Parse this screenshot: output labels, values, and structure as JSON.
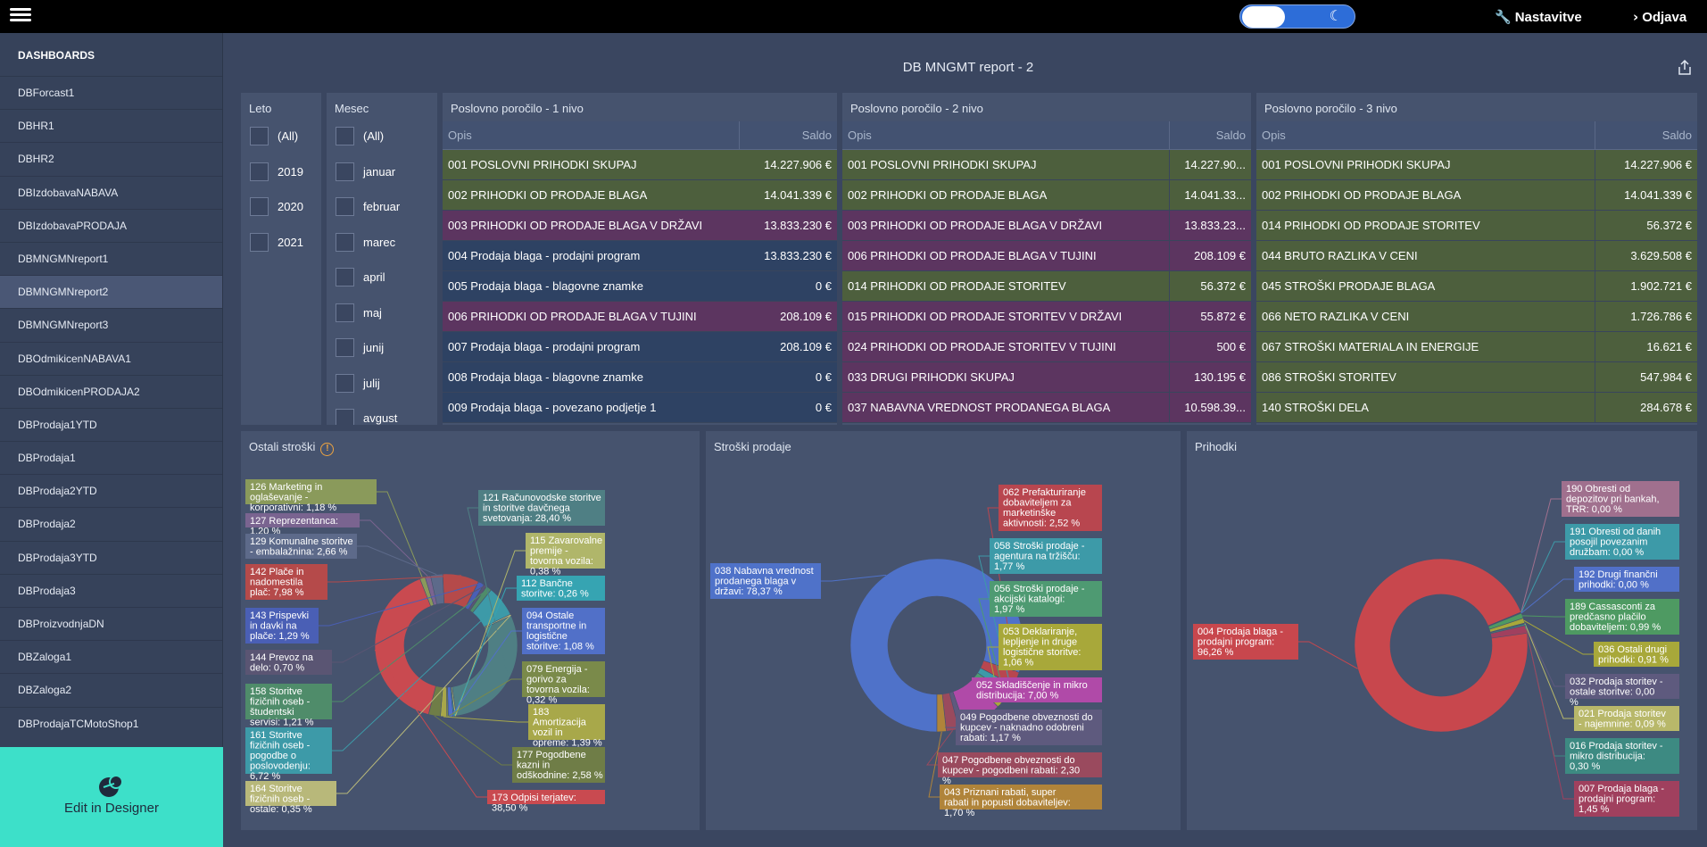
{
  "topbar": {
    "settings_label": "Nastavitve",
    "logout_label": "Odjava",
    "moon_glyph": "☾"
  },
  "sidebar": {
    "title": "DASHBOARDS",
    "items": [
      {
        "label": "DBForcast1"
      },
      {
        "label": "DBHR1"
      },
      {
        "label": "DBHR2"
      },
      {
        "label": "DBIzdobavaNABAVA"
      },
      {
        "label": "DBIzdobavaPRODAJA"
      },
      {
        "label": "DBMNGMNreport1"
      },
      {
        "label": "DBMNGMNreport2",
        "active": true
      },
      {
        "label": "DBMNGMNreport3"
      },
      {
        "label": "DBOdmikicenNABAVA1"
      },
      {
        "label": "DBOdmikicenPRODAJA2"
      },
      {
        "label": "DBProdaja1YTD"
      },
      {
        "label": "DBProdaja1"
      },
      {
        "label": "DBProdaja2YTD"
      },
      {
        "label": "DBProdaja2"
      },
      {
        "label": "DBProdaja3YTD"
      },
      {
        "label": "DBProdaja3"
      },
      {
        "label": "DBProizvodnjaDN"
      },
      {
        "label": "DBZaloga1"
      },
      {
        "label": "DBZaloga2"
      },
      {
        "label": "DBProdajaTCMotoShop1"
      }
    ],
    "designer_label": "Edit in Designer"
  },
  "main": {
    "title": "DB MNGMT report - 2"
  },
  "filters": {
    "leto": {
      "title": "Leto",
      "options": [
        "(All)",
        "2019",
        "2020",
        "2021"
      ]
    },
    "mesec": {
      "title": "Mesec",
      "options": [
        "(All)",
        "januar",
        "februar",
        "marec",
        "april",
        "maj",
        "junij",
        "julij",
        "avgust"
      ]
    }
  },
  "grids": [
    {
      "title": "Poslovno poročilo - 1 nivo",
      "col_opis": "Opis",
      "col_saldo": "Saldo",
      "rows": [
        {
          "opis": "001 POSLOVNI PRIHODKI SKUPAJ",
          "saldo": "14.227.906 €",
          "color": "#4d5f3d"
        },
        {
          "opis": "002 PRIHODKI OD PRODAJE BLAGA",
          "saldo": "14.041.339 €",
          "color": "#4d5f3d"
        },
        {
          "opis": "003 PRIHODKI OD PRODAJE BLAGA V DRŽAVI",
          "saldo": "13.833.230 €",
          "color": "#5c3560"
        },
        {
          "opis": "004 Prodaja blaga - prodajni program",
          "saldo": "13.833.230 €",
          "color": "#2e4263"
        },
        {
          "opis": "005 Prodaja blaga - blagovne znamke",
          "saldo": "0 €",
          "color": "#2e4263"
        },
        {
          "opis": "006 PRIHODKI OD PRODAJE BLAGA V TUJINI",
          "saldo": "208.109 €",
          "color": "#5c3560"
        },
        {
          "opis": "007 Prodaja blaga - prodajni program",
          "saldo": "208.109 €",
          "color": "#2e4263"
        },
        {
          "opis": "008 Prodaja blaga - blagovne znamke",
          "saldo": "0 €",
          "color": "#2e4263"
        },
        {
          "opis": "009 Prodaja blaga - povezano podjetje 1",
          "saldo": "0 €",
          "color": "#2e4263"
        }
      ]
    },
    {
      "title": "Poslovno poročilo - 2 nivo",
      "col_opis": "Opis",
      "col_saldo": "Saldo",
      "rows": [
        {
          "opis": "001 POSLOVNI PRIHODKI SKUPAJ",
          "saldo": "14.227.90...",
          "color": "#4d5f3d"
        },
        {
          "opis": "002 PRIHODKI OD PRODAJE BLAGA",
          "saldo": "14.041.33...",
          "color": "#4d5f3d"
        },
        {
          "opis": "003 PRIHODKI OD PRODAJE BLAGA V DRŽAVI",
          "saldo": "13.833.23...",
          "color": "#5c3560"
        },
        {
          "opis": "006 PRIHODKI OD PRODAJE BLAGA V TUJINI",
          "saldo": "208.109 €",
          "color": "#5c3560"
        },
        {
          "opis": "014 PRIHODKI OD PRODAJE STORITEV",
          "saldo": "56.372 €",
          "color": "#4d5f3d"
        },
        {
          "opis": "015 PRIHODKI OD PRODAJE STORITEV V DRŽAVI",
          "saldo": "55.872 €",
          "color": "#5c3560"
        },
        {
          "opis": "024 PRIHODKI OD PRODAJE STORITEV V TUJINI",
          "saldo": "500 €",
          "color": "#5c3560"
        },
        {
          "opis": "033 DRUGI PRIHODKI SKUPAJ",
          "saldo": "130.195 €",
          "color": "#5c3560"
        },
        {
          "opis": "037 NABAVNA VREDNOST PRODANEGA BLAGA",
          "saldo": "10.598.39...",
          "color": "#5c3560"
        }
      ]
    },
    {
      "title": "Poslovno poročilo - 3 nivo",
      "col_opis": "Opis",
      "col_saldo": "Saldo",
      "rows": [
        {
          "opis": "001 POSLOVNI PRIHODKI SKUPAJ",
          "saldo": "14.227.906 €",
          "color": "#4d5f3d"
        },
        {
          "opis": "002 PRIHODKI OD PRODAJE BLAGA",
          "saldo": "14.041.339 €",
          "color": "#4d5f3d"
        },
        {
          "opis": "014 PRIHODKI OD PRODAJE STORITEV",
          "saldo": "56.372 €",
          "color": "#4d5f3d"
        },
        {
          "opis": "044 BRUTO RAZLIKA V CENI",
          "saldo": "3.629.508 €",
          "color": "#4d5f3d"
        },
        {
          "opis": "045 STROŠKI PRODAJE BLAGA",
          "saldo": "1.902.721 €",
          "color": "#4d5f3d"
        },
        {
          "opis": "066 NETO RAZLIKA V CENI",
          "saldo": "1.726.786 €",
          "color": "#4d5f3d"
        },
        {
          "opis": "067 STROŠKI MATERIALA IN ENERGIJE",
          "saldo": "16.621 €",
          "color": "#4d5f3d"
        },
        {
          "opis": "086 STROŠKI STORITEV",
          "saldo": "547.984 €",
          "color": "#4d5f3d"
        },
        {
          "opis": "140 STROŠKI DELA",
          "saldo": "284.678 €",
          "color": "#4d5f3d"
        }
      ]
    }
  ],
  "chart_data": [
    {
      "type": "pie",
      "title": "Ostali stroški",
      "series": [
        {
          "label": "126 Marketing in oglaševanje - korporativni: 1,18 %",
          "value": 1.18,
          "color": "#8a9a5b",
          "side": "left"
        },
        {
          "label": "127 Reprezentanca: 1,20 %",
          "value": 1.2,
          "color": "#7a6490",
          "side": "left"
        },
        {
          "label": "129 Komunalne storitve - embalažnina: 2,66 %",
          "value": 2.66,
          "color": "#5d6a8a",
          "side": "left"
        },
        {
          "label": "142 Plače in nadomestila plač: 7,98 %",
          "value": 7.98,
          "color": "#b54a4a",
          "side": "left"
        },
        {
          "label": "143 Prispevki in davki na plače: 1,29 %",
          "value": 1.29,
          "color": "#4a5fb5",
          "side": "left"
        },
        {
          "label": "144 Prevoz na delo: 0,70 %",
          "value": 0.7,
          "color": "#5a5573",
          "side": "left"
        },
        {
          "label": "158 Storitve fizičnih oseb - študentski servisi: 1,21 %",
          "value": 1.21,
          "color": "#4f8c6a",
          "side": "left"
        },
        {
          "label": "161 Storitve fizičnih oseb - pogodbe o poslovodenju: 6,72 %",
          "value": 6.72,
          "color": "#3d9aa8",
          "side": "left"
        },
        {
          "label": "164 Storitve fizičnih oseb - ostale: 0,35 %",
          "value": 0.35,
          "color": "#b8b87a",
          "side": "left"
        },
        {
          "label": "121 Računovodske storitve in storitve davčnega svetovanja: 28,40 %",
          "value": 28.4,
          "color": "#4f7f84",
          "side": "right"
        },
        {
          "label": "115 Zavarovalne premije - tovorna vozila: 0,38 %",
          "value": 0.38,
          "color": "#b0b66a",
          "side": "right"
        },
        {
          "label": "112 Bančne storitve: 0,26 %",
          "value": 0.26,
          "color": "#36a4b2",
          "side": "right"
        },
        {
          "label": "094 Ostale transportne in logistične storitve: 1,08 %",
          "value": 1.08,
          "color": "#5170c8",
          "side": "right"
        },
        {
          "label": "079 Energija - gorivo za tovorna vozila: 0,32 %",
          "value": 0.32,
          "color": "#7a8a4a",
          "side": "right"
        },
        {
          "label": "183 Amortizacija vozil in opreme: 1,39 %",
          "value": 1.39,
          "color": "#a8a84a",
          "side": "right"
        },
        {
          "label": "177 Pogodbene kazni in odškodnine: 2,58 %",
          "value": 2.58,
          "color": "#6f7d47",
          "side": "right"
        },
        {
          "label": "173 Odpisi terjatev: 38,50 %",
          "value": 38.5,
          "color": "#c94a50",
          "side": "right"
        }
      ]
    },
    {
      "type": "pie",
      "title": "Stroški prodaje",
      "series": [
        {
          "label": "038 Nabavna vrednost prodanega blaga v državi: 78,37 %",
          "value": 78.37,
          "color": "#4f72c9",
          "side": "left"
        },
        {
          "label": "062 Prefakturiranje dobaviteljem za marketinške aktivnosti: 2,52 %",
          "value": 2.52,
          "color": "#b8464f",
          "side": "right"
        },
        {
          "label": "058 Stroški prodaje - agentura na tržišču: 1,77 %",
          "value": 1.77,
          "color": "#3d9aa8",
          "side": "right"
        },
        {
          "label": "056 Stroški prodaje - akcijski katalogi: 1,97 %",
          "value": 1.97,
          "color": "#4e9a72",
          "side": "right"
        },
        {
          "label": "053 Deklariranje, lepljenje in druge logistične storitve: 1,06 %",
          "value": 1.06,
          "color": "#a8a83a",
          "side": "right"
        },
        {
          "label": "052 Skladiščenje in mikro distribucija: 7,00 %",
          "value": 7.0,
          "color": "#b04aa8",
          "side": "right"
        },
        {
          "label": "049 Pogodbene obveznosti do kupcev - naknadno odobreni rabati: 1,17 %",
          "value": 1.17,
          "color": "#5e5a7e",
          "side": "right"
        },
        {
          "label": "047 Pogodbene obveznosti do kupcev - pogodbeni rabati: 2,30 %",
          "value": 2.3,
          "color": "#9a4a5e",
          "side": "right"
        },
        {
          "label": "043 Priznani rabati, super rabati in popusti dobaviteljev: 1,70 %",
          "value": 1.7,
          "color": "#b0843a",
          "side": "right"
        }
      ]
    },
    {
      "type": "pie",
      "title": "Prihodki",
      "series": [
        {
          "label": "004 Prodaja blaga - prodajni program: 96,26 %",
          "value": 96.26,
          "color": "#c8474d",
          "side": "left"
        },
        {
          "label": "190 Obresti od depozitov pri bankah, TRR: 0,00 %",
          "value": 0.0,
          "color": "#a0708e",
          "side": "right"
        },
        {
          "label": "191 Obresti od danih posojil povezanim družbam: 0,00 %",
          "value": 0.0,
          "color": "#3d9aa8",
          "side": "right"
        },
        {
          "label": "192 Drugi finančni prihodki: 0,00 %",
          "value": 0.0,
          "color": "#5170c8",
          "side": "right"
        },
        {
          "label": "189 Cassasconti za predčasno plačilo dobaviteljem: 0,99 %",
          "value": 0.99,
          "color": "#4e9a62",
          "side": "right"
        },
        {
          "label": "036 Ostali drugi prihodki: 0,91 %",
          "value": 0.91,
          "color": "#a8a83a",
          "side": "right"
        },
        {
          "label": "032 Prodaja storitev - ostale storitve: 0,00 %",
          "value": 0.0,
          "color": "#5e5a7e",
          "side": "right"
        },
        {
          "label": "021 Prodaja storitev - najemnine: 0,09 %",
          "value": 0.09,
          "color": "#b8b86a",
          "side": "right"
        },
        {
          "label": "016 Prodaja storitev - mikro distribucija: 0,30 %",
          "value": 0.3,
          "color": "#3d8a82",
          "side": "right"
        },
        {
          "label": "007 Prodaja blaga - prodajni program: 1,45 %",
          "value": 1.45,
          "color": "#a0405e",
          "side": "right"
        }
      ]
    }
  ]
}
